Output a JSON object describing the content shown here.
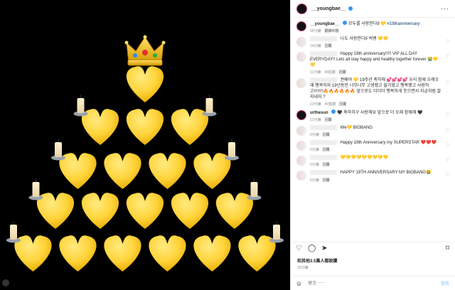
{
  "post": {
    "username": "__youngbae__",
    "more_label": "···",
    "caption_text": "모두를 사랑한다9 💛",
    "caption_tag": "#19thanniversary",
    "caption_time": "35分鐘",
    "caption_translate": "翻譯年糕"
  },
  "comments": [
    {
      "text": "나도 사랑한다9 빅뱅 💛💛",
      "time": "14分鐘",
      "likes": "",
      "reply": "回覆"
    },
    {
      "text": "Happy 19th anniversary!!!!! VIP ALL DAY EVERYDAY!! Lets all stay happy and healthy together forever 😭💛💛",
      "time": "11分鐘",
      "likes": "46個讚",
      "reply": "回覆"
    },
    {
      "text": "권배야 💛 19주년 축하해 💕💕💕💕 우리 함께 오래오래 행복하자 19년동안 너무너무 고생했고 쓸거웠고 행복했고 사랑하고!!!!!!!!🔥🔥🔥🔥🔥🔥 앞으로도 더더더 행복하게 웃으면서 지금처럼 잘지내자 ?",
      "time": "13分鐘",
      "likes": "40個讚",
      "reply": "回覆"
    },
    {
      "user": "urthesun",
      "text": "🖤 축하하구 사랑해요 앞으로 더 오래 함께해 🖤",
      "time": "12分鐘",
      "likes": "",
      "reply": "回覆"
    },
    {
      "text": "We💛 BIGBANG",
      "time": "6分鐘",
      "likes": "",
      "reply": "回覆"
    },
    {
      "text": "Happy 19th Anniversary my SUPERSTAR ❤️❤️❤️",
      "time": "5分鐘",
      "likes": "",
      "reply": "回覆"
    },
    {
      "text": "💛💛💛💛💛💛💛💛💛",
      "time": "5分鐘",
      "likes": "",
      "reply": "回覆"
    },
    {
      "text": "HAPPY 19TH ANNIVERSARY MY BIGBANG😭",
      "time": "5分鐘",
      "likes": "",
      "reply": "回覆"
    }
  ],
  "likes_text": "和其他3.5萬人都說讚",
  "time_text": "15分鐘",
  "add_comment": {
    "emoji": "☺",
    "placeholder": "留言⋯⋯",
    "post_label": "發佈"
  },
  "colors": {
    "heart": "#FFD43B",
    "background": "#000000",
    "accent": "#3897f0"
  }
}
